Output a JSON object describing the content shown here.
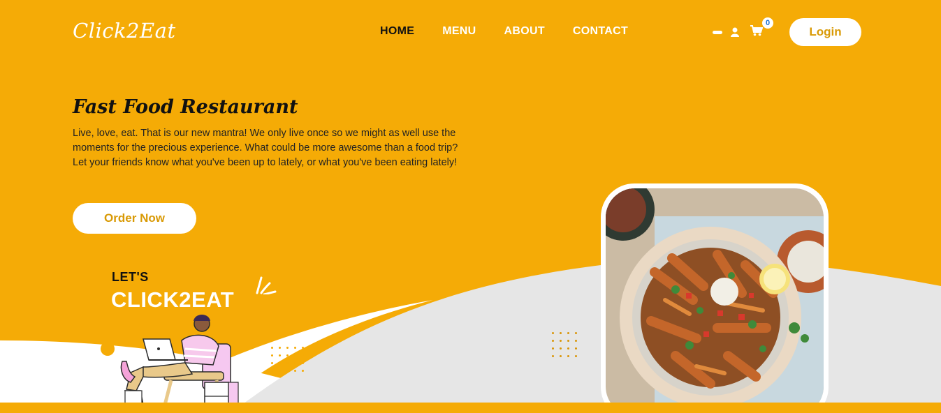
{
  "header": {
    "logo": "Click2Eat",
    "nav": [
      {
        "label": "HOME",
        "active": true
      },
      {
        "label": "MENU",
        "active": false
      },
      {
        "label": "ABOUT",
        "active": false
      },
      {
        "label": "CONTACT",
        "active": false
      }
    ],
    "icons": [
      "dash-icon",
      "user-icon",
      "cart-icon"
    ],
    "cart_count": "0",
    "login_label": "Login"
  },
  "hero": {
    "title": "Fast Food Restaurant",
    "text": "Live, love, eat. That is our new mantra! We only live once so we might as well use the moments for the precious experience. What could be more awesome than a food trip? Let your friends know what you've been up to lately, or what you've been eating lately!",
    "order_label": "Order Now"
  },
  "promo": {
    "lets": "LET'S",
    "brand": "CLICK2EAT"
  },
  "colors": {
    "accent": "#f5ab06",
    "accent_text": "#d99a06",
    "wave_gray": "#e6e6e6",
    "white": "#ffffff"
  }
}
